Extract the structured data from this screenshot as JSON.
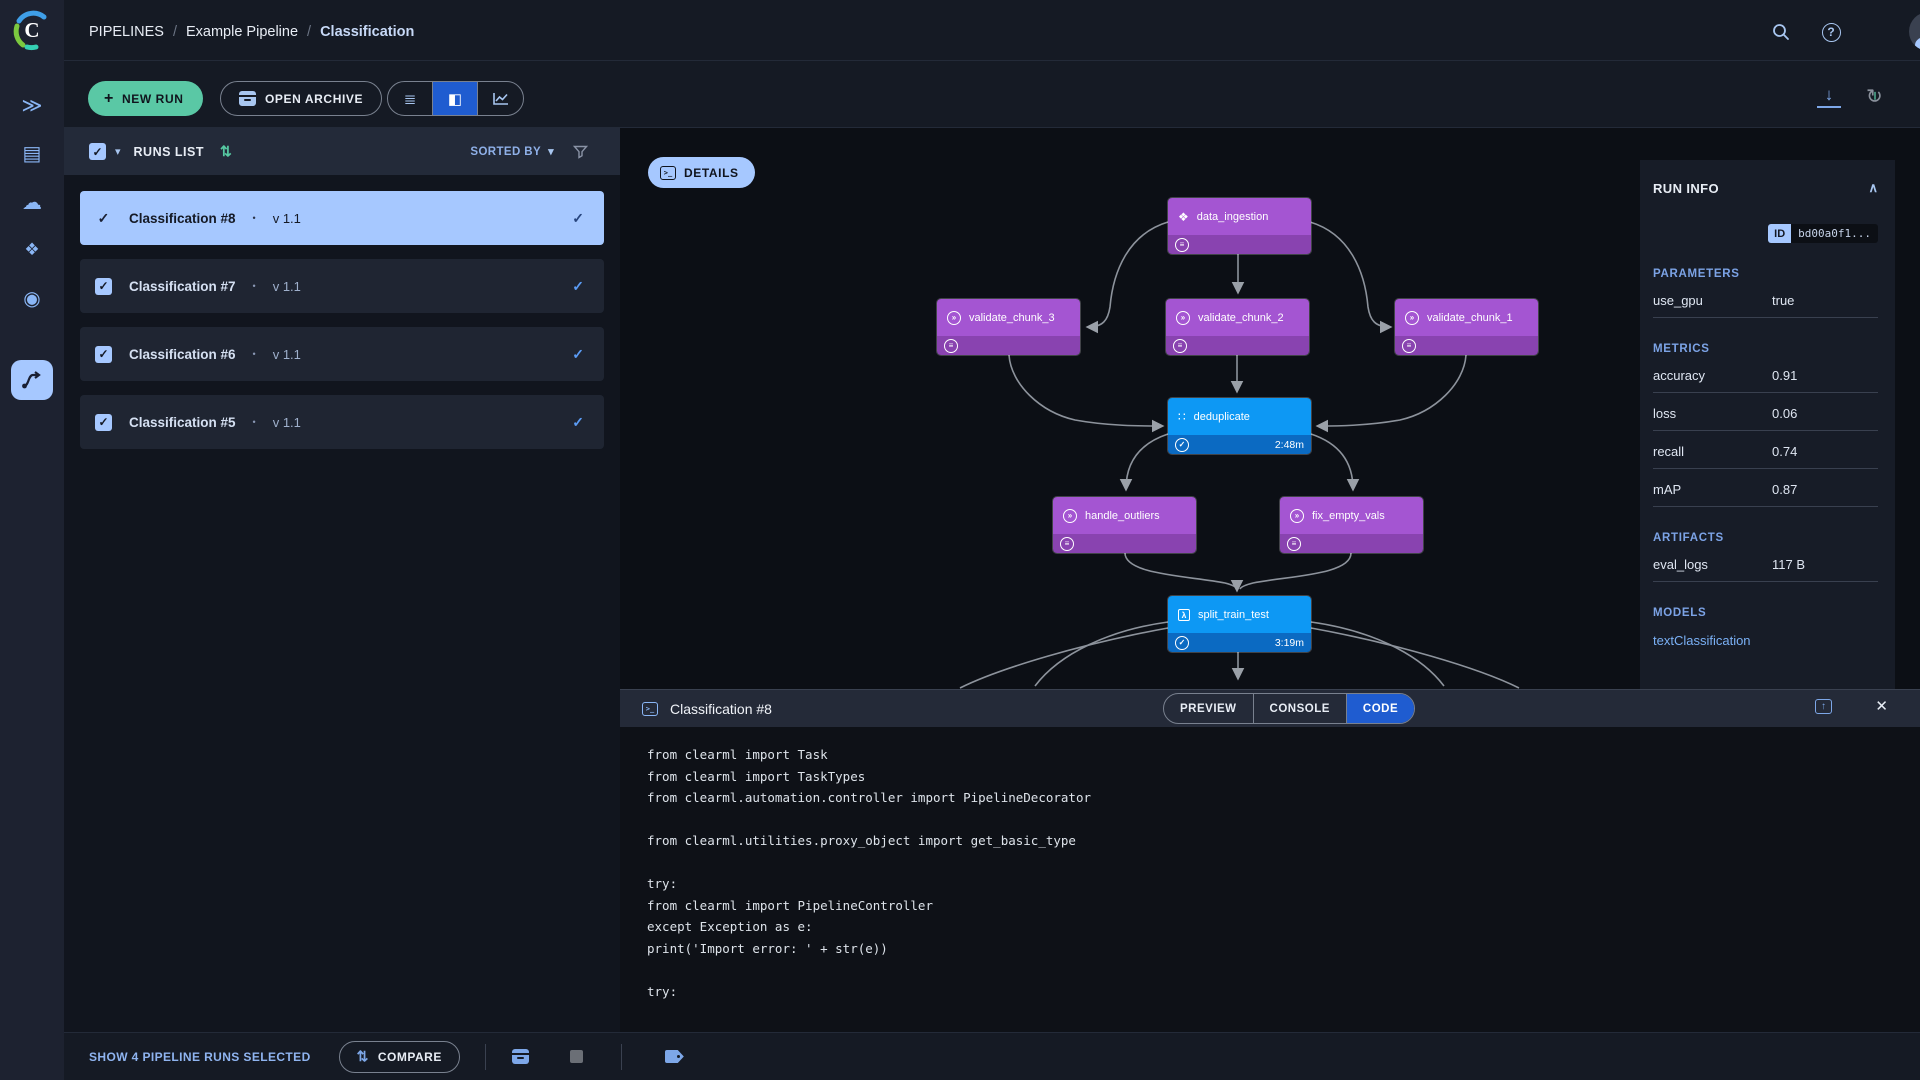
{
  "breadcrumb": {
    "items": [
      "PIPELINES",
      "Example Pipeline",
      "Classification"
    ],
    "separator": "/"
  },
  "toolbar": {
    "new_run": "NEW RUN",
    "open_archive": "OPEN ARCHIVE"
  },
  "runs_list": {
    "title": "RUNS LIST",
    "sorted_by": "SORTED BY",
    "items": [
      {
        "name": "Classification #8",
        "version": "v 1.1",
        "selected": true
      },
      {
        "name": "Classification #7",
        "version": "v 1.1",
        "selected": false
      },
      {
        "name": "Classification #6",
        "version": "v 1.1",
        "selected": false
      },
      {
        "name": "Classification #5",
        "version": "v 1.1",
        "selected": false
      }
    ]
  },
  "dag": {
    "details_label": "DETAILS",
    "nodes": [
      {
        "label": "data_ingestion",
        "type": "purple",
        "icon": "dataset-icon"
      },
      {
        "label": "validate_chunk_3",
        "type": "purple",
        "icon": "chevrons-circle-icon"
      },
      {
        "label": "validate_chunk_2",
        "type": "purple",
        "icon": "chevrons-circle-icon"
      },
      {
        "label": "validate_chunk_1",
        "type": "purple",
        "icon": "chevrons-circle-icon"
      },
      {
        "label": "deduplicate",
        "type": "blue",
        "icon": "grid-dots-icon",
        "time": "2:48m"
      },
      {
        "label": "handle_outliers",
        "type": "purple",
        "icon": "chevrons-circle-icon"
      },
      {
        "label": "fix_empty_vals",
        "type": "purple",
        "icon": "chevrons-circle-icon"
      },
      {
        "label": "split_train_test",
        "type": "blue",
        "icon": "lambda-icon",
        "time": "3:19m"
      }
    ]
  },
  "run_info": {
    "title": "RUN INFO",
    "id_label": "ID",
    "id_value": "bd00a0f1...",
    "params_title": "PARAMETERS",
    "params": [
      {
        "label": "use_gpu",
        "value": "true"
      }
    ],
    "metrics_title": "METRICS",
    "metrics": [
      {
        "label": "accuracy",
        "value": "0.91"
      },
      {
        "label": "loss",
        "value": "0.06"
      },
      {
        "label": "recall",
        "value": "0.74"
      },
      {
        "label": "mAP",
        "value": "0.87"
      }
    ],
    "artifacts_title": "ARTIFACTS",
    "artifacts": [
      {
        "label": "eval_logs",
        "value": "117 B"
      }
    ],
    "models_title": "MODELS",
    "models": [
      "textClassification"
    ]
  },
  "bottom_panel": {
    "title": "Classification #8",
    "tabs": [
      "PREVIEW",
      "CONSOLE",
      "CODE"
    ],
    "active_tab": "CODE",
    "code_lines": [
      "from clearml import Task",
      "from clearml import TaskTypes",
      "from clearml.automation.controller import PipelineDecorator",
      "",
      "from clearml.utilities.proxy_object import get_basic_type",
      "",
      "try:",
      "from clearml import PipelineController",
      "except Exception as e:",
      "print('Import error: ' + str(e))",
      "",
      "try:"
    ]
  },
  "footer": {
    "selected_text": "SHOW 4 PIPELINE RUNS SELECTED",
    "compare_label": "COMPARE"
  },
  "glyphs": {
    "plus": "+",
    "caret_down": "▾",
    "sort": "⇅",
    "check": "✓",
    "dot": "•",
    "chevron_up": "∧",
    "help": "?",
    "close": "✕",
    "menu": "≡",
    "dchev": "»",
    "lambda": "λ",
    "grid_dots": "∷",
    "dataset": "❖",
    "download": "↓",
    "refresh": "↻",
    "pause": "∥",
    "up_arrow": "↑",
    "projects": "≫",
    "workers": "▤",
    "cloud": "☁",
    "models": "◉",
    "list_view": "≣",
    "split_view": "◧",
    "compare": "⇅",
    "terminal": ">_",
    "slash": "/"
  }
}
